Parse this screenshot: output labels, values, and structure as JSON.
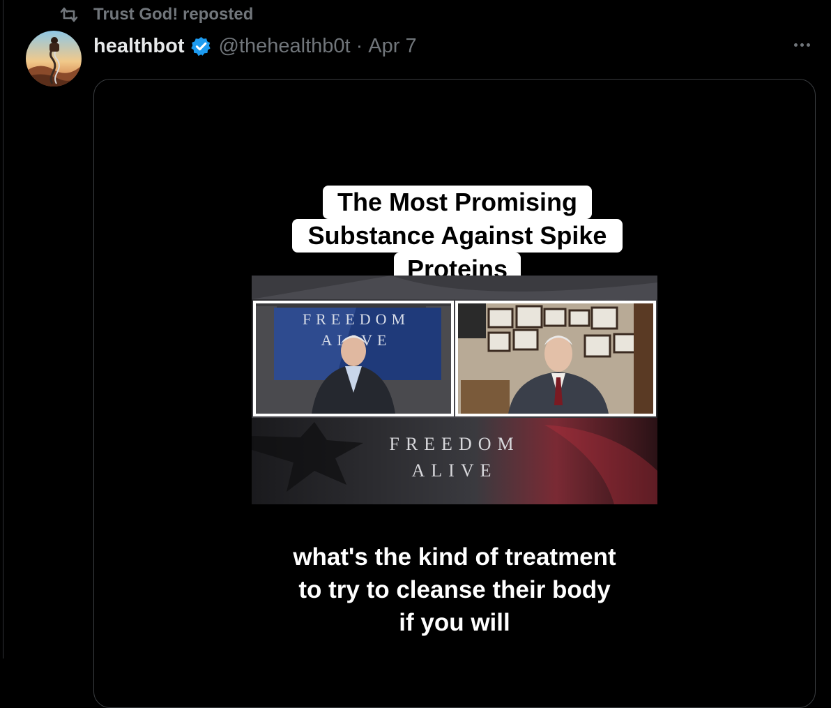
{
  "repost": {
    "label": "Trust God! reposted",
    "icon": "repost-icon"
  },
  "post": {
    "author_name": "healthbot",
    "verified": true,
    "handle": "@thehealthb0t",
    "separator": "·",
    "date": "Apr 7"
  },
  "video": {
    "title_lines": [
      "The Most Promising",
      "Substance Against Spike",
      "Proteins"
    ],
    "inset_brand_top": "FREEDOM",
    "inset_brand_top2": "ALIVE",
    "lower_brand_line1": "FREEDOM",
    "lower_brand_line2": "ALIVE",
    "subtitle_lines": [
      "what's the kind of treatment",
      "to try to cleanse their body",
      "if you will"
    ]
  },
  "colors": {
    "background": "#000000",
    "muted": "#71767b",
    "verified": "#1d9bf0",
    "text": "#e7e9ea"
  }
}
